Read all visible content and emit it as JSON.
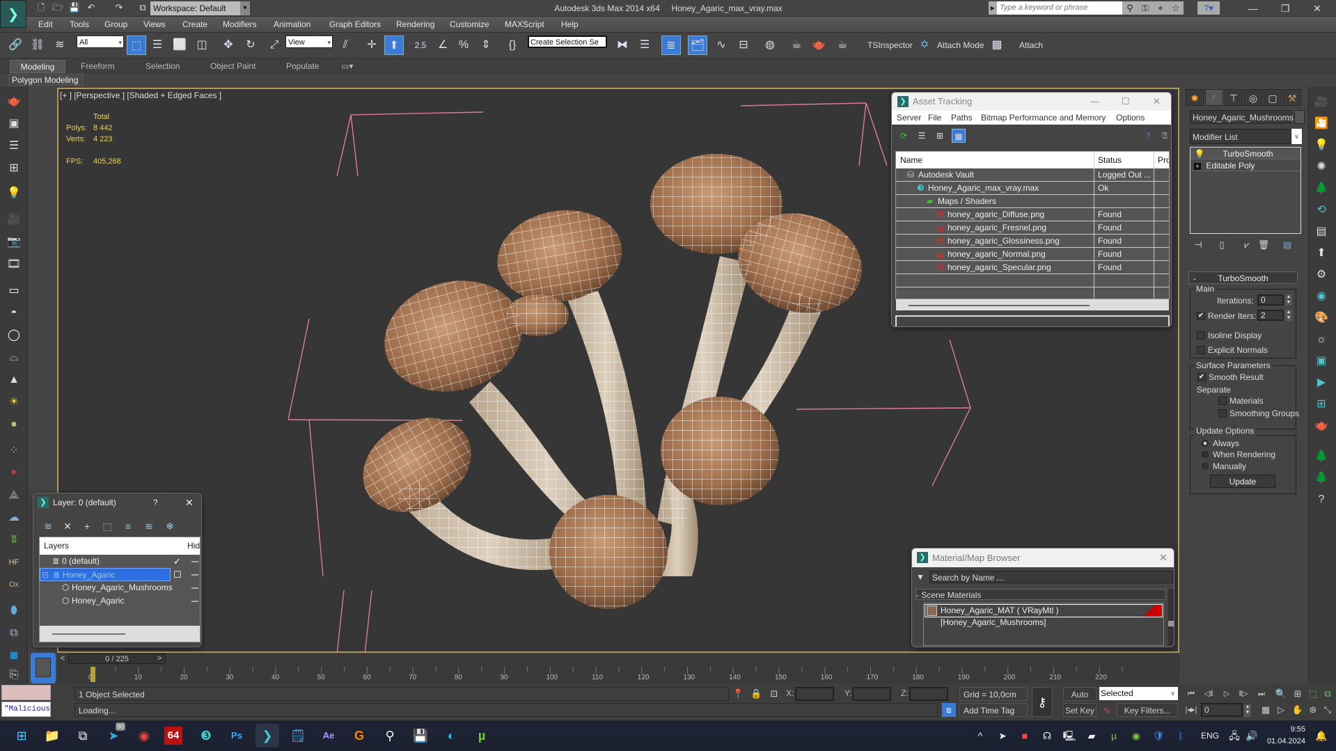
{
  "window": {
    "app_title": "Autodesk 3ds Max  2014 x64",
    "file_name": "Honey_Agaric_max_vray.max",
    "workspace": "Workspace: Default",
    "search_placeholder": "Type a keyword or phrase",
    "controls": {
      "minimize": "—",
      "maximize": "❐",
      "close": "✕"
    }
  },
  "menu": [
    "Edit",
    "Tools",
    "Group",
    "Views",
    "Create",
    "Modifiers",
    "Animation",
    "Graph Editors",
    "Rendering",
    "Customize",
    "MAXScript",
    "Help"
  ],
  "toolbar": {
    "selection_filter": "All",
    "ref_coord": "View",
    "snap_angle": "2.5",
    "named_selection_placeholder": "Create Selection Se",
    "tsinspector": "TSInspector",
    "attach_mode": "Attach Mode",
    "attach": "Attach"
  },
  "ribbon": {
    "tabs": [
      "Modeling",
      "Freeform",
      "Selection",
      "Object Paint",
      "Populate"
    ],
    "active_tab": "Modeling",
    "panel": "Polygon Modeling"
  },
  "viewport": {
    "label": "[+ ] [Perspective ] [Shaded + Edged Faces ]",
    "stats": {
      "header": "Total",
      "polys_label": "Polys:",
      "polys": "8 442",
      "verts_label": "Verts:",
      "verts": "4 223",
      "fps_label": "FPS:",
      "fps": "405,268"
    }
  },
  "command_panel": {
    "object_name": "Honey_Agaric_Mushrooms",
    "modifier_list": "Modifier List",
    "stack": [
      "TurboSmooth",
      "Editable Poly"
    ],
    "rollout": "TurboSmooth",
    "main_group": "Main",
    "iterations_label": "Iterations:",
    "iterations": "0",
    "render_iters_label": "Render Iters:",
    "render_iters": "2",
    "render_iters_checked": true,
    "isoline_display": "Isoline Display",
    "explicit_normals": "Explicit Normals",
    "surface_group": "Surface Parameters",
    "smooth_result": "Smooth Result",
    "separate": "Separate",
    "materials": "Materials",
    "smoothing_groups": "Smoothing Groups",
    "update_group": "Update Options",
    "update_options": [
      "Always",
      "When Rendering",
      "Manually"
    ],
    "update_selected": "Always",
    "update_button": "Update"
  },
  "asset_tracking": {
    "title": "Asset Tracking",
    "menu": [
      "Server",
      "File",
      "Paths",
      "Bitmap Performance and Memory",
      "Options"
    ],
    "columns": [
      "Name",
      "Status",
      "Pro"
    ],
    "rows": [
      {
        "name": "Autodesk Vault",
        "status": "Logged Out ...",
        "indent": 1,
        "icon": "vault-icon"
      },
      {
        "name": "Honey_Agaric_max_vray.max",
        "status": "Ok",
        "indent": 2,
        "icon": "max-file-icon"
      },
      {
        "name": "Maps / Shaders",
        "status": "",
        "indent": 3,
        "icon": "maps-icon"
      },
      {
        "name": "honey_agaric_Diffuse.png",
        "status": "Found",
        "indent": 4,
        "icon": "png-icon"
      },
      {
        "name": "honey_agaric_Fresnel.png",
        "status": "Found",
        "indent": 4,
        "icon": "png-icon"
      },
      {
        "name": "honey_agaric_Glossiness.png",
        "status": "Found",
        "indent": 4,
        "icon": "png-icon"
      },
      {
        "name": "honey_agaric_Normal.png",
        "status": "Found",
        "indent": 4,
        "icon": "png-icon"
      },
      {
        "name": "honey_agaric_Specular.png",
        "status": "Found",
        "indent": 4,
        "icon": "png-icon"
      }
    ]
  },
  "layer_dialog": {
    "title": "Layer: 0 (default)",
    "help": "?",
    "columns": [
      "Layers",
      "Hid"
    ],
    "rows": [
      {
        "name": "0 (default)",
        "type": "layer",
        "checked": "✓"
      },
      {
        "name": "Honey_Agaric",
        "type": "layer",
        "selected": true,
        "checked": "☐"
      },
      {
        "name": "Honey_Agaric_Mushrooms",
        "type": "object"
      },
      {
        "name": "Honey_Agaric",
        "type": "object"
      }
    ]
  },
  "material_browser": {
    "title": "Material/Map Browser",
    "search_placeholder": "Search by Name ...",
    "category": "- Scene Materials",
    "item": "Honey_Agaric_MAT  ( VRayMtl )  [Honey_Agaric_Mushrooms]"
  },
  "timeline": {
    "slider": "0 / 225",
    "current_frame": 0,
    "total_frames": 225,
    "ticks": [
      "0",
      "10",
      "20",
      "30",
      "40",
      "50",
      "60",
      "70",
      "80",
      "90",
      "100",
      "110",
      "120",
      "130",
      "140",
      "150",
      "160",
      "170",
      "180",
      "190",
      "200",
      "210",
      "220"
    ]
  },
  "status": {
    "listener_text": "\"Malicious s",
    "prompt1": "1 Object Selected",
    "prompt2": "Loading...",
    "x_label": "X:",
    "y_label": "Y:",
    "z_label": "Z:",
    "grid": "Grid = 10,0cm",
    "add_time_tag": "Add Time Tag",
    "auto_key": "Auto Key",
    "set_key": "Set Key",
    "key_mode": "Selected",
    "key_filters": "Key Filters...",
    "frame": "0"
  },
  "taskbar": {
    "apps": [
      "windows-start",
      "file-explorer",
      "task-view",
      "telegram",
      "chrome",
      "aida64",
      "3ds-max-2014",
      "photoshop",
      "3ds-max-active",
      "notepad",
      "after-effects",
      "topaz-gigapixel",
      "obs",
      "floppy-save",
      "edge",
      "utorrent"
    ],
    "telegram_badge": "90",
    "aida_label": "64",
    "language": "ENG",
    "time": "9:55",
    "date": "01.04.2024"
  }
}
